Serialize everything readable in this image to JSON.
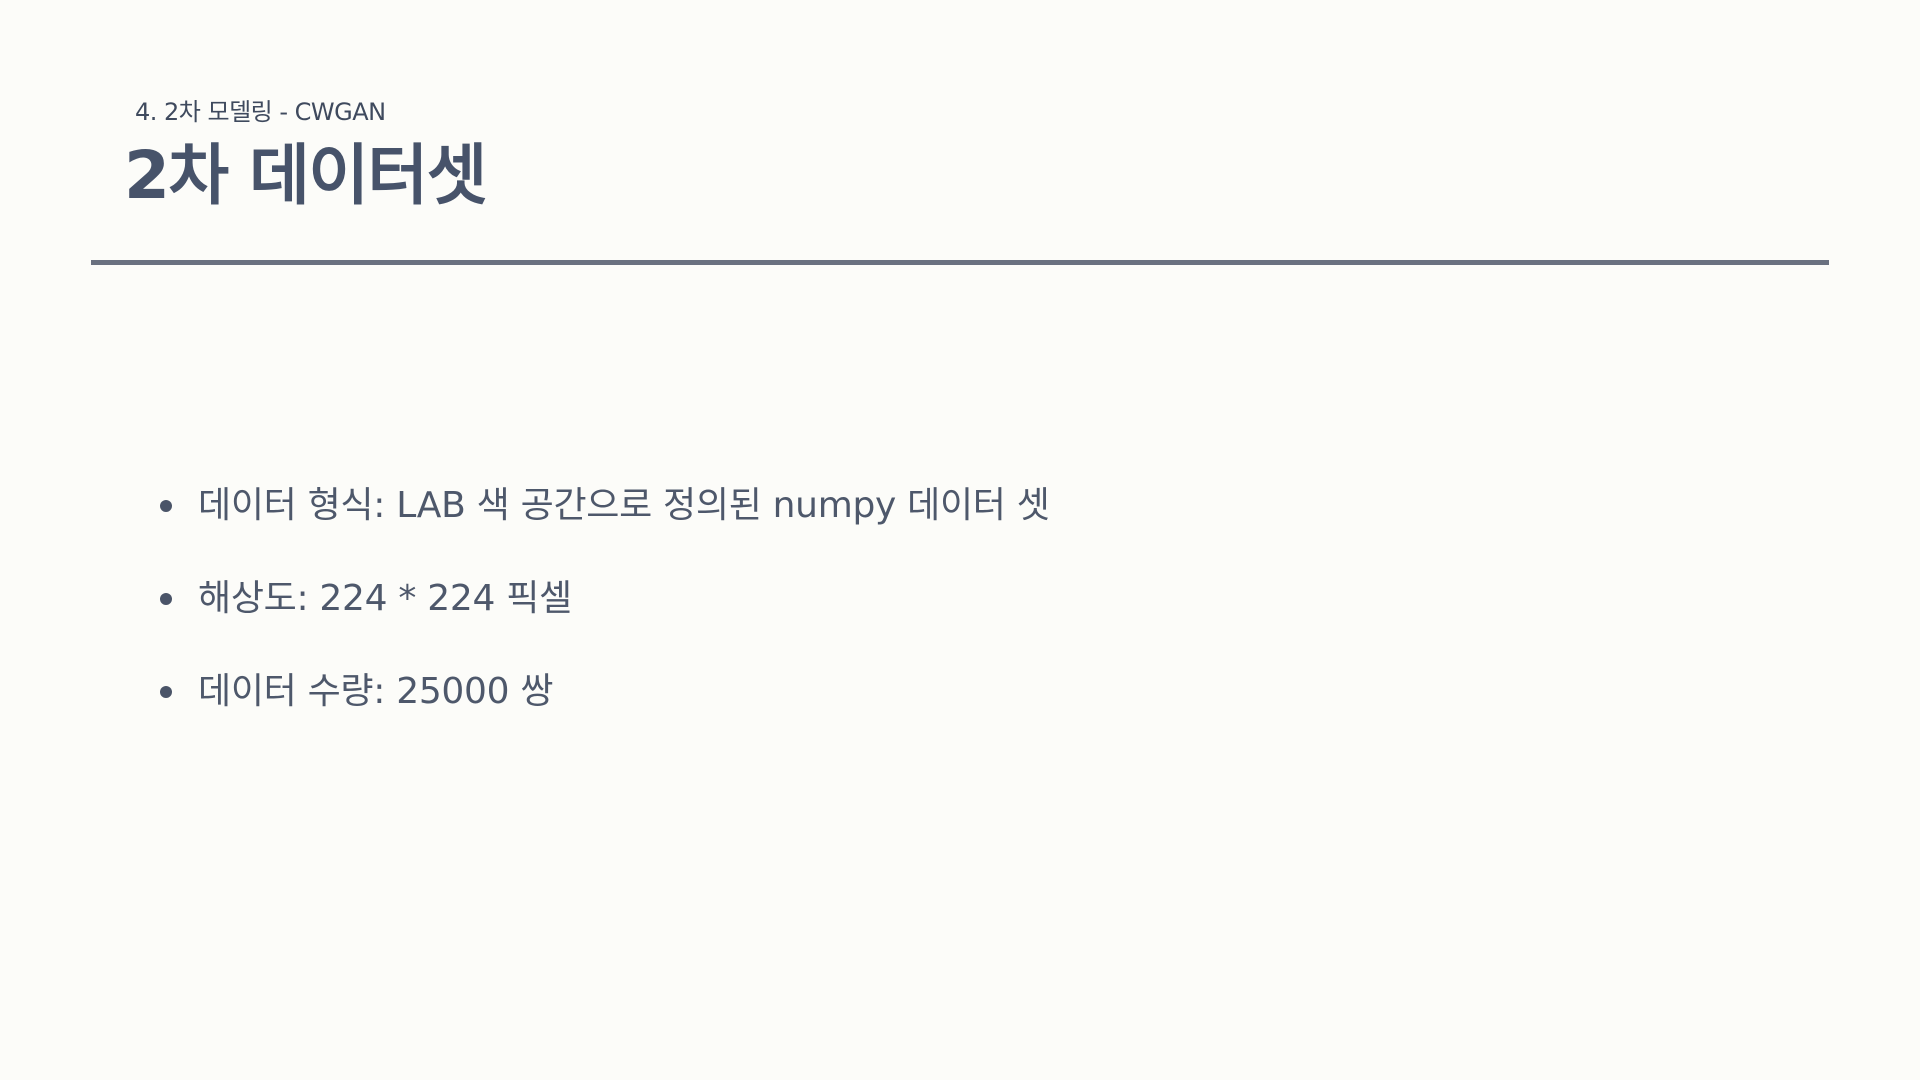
{
  "header": {
    "section_label": "4. 2차 모델링 -  CWGAN",
    "title": "2차 데이터셋"
  },
  "bullets": [
    {
      "text": "데이터 형식: LAB 색 공간으로 정의된 numpy 데이터 셋"
    },
    {
      "text": "해상도: 224 * 224 픽셀"
    },
    {
      "text": "데이터 수량: 25000 쌍"
    }
  ],
  "colors": {
    "background": "#fcfcf9",
    "title": "#47536a",
    "rule": "#6a7180",
    "body_text": "#4e586b"
  }
}
